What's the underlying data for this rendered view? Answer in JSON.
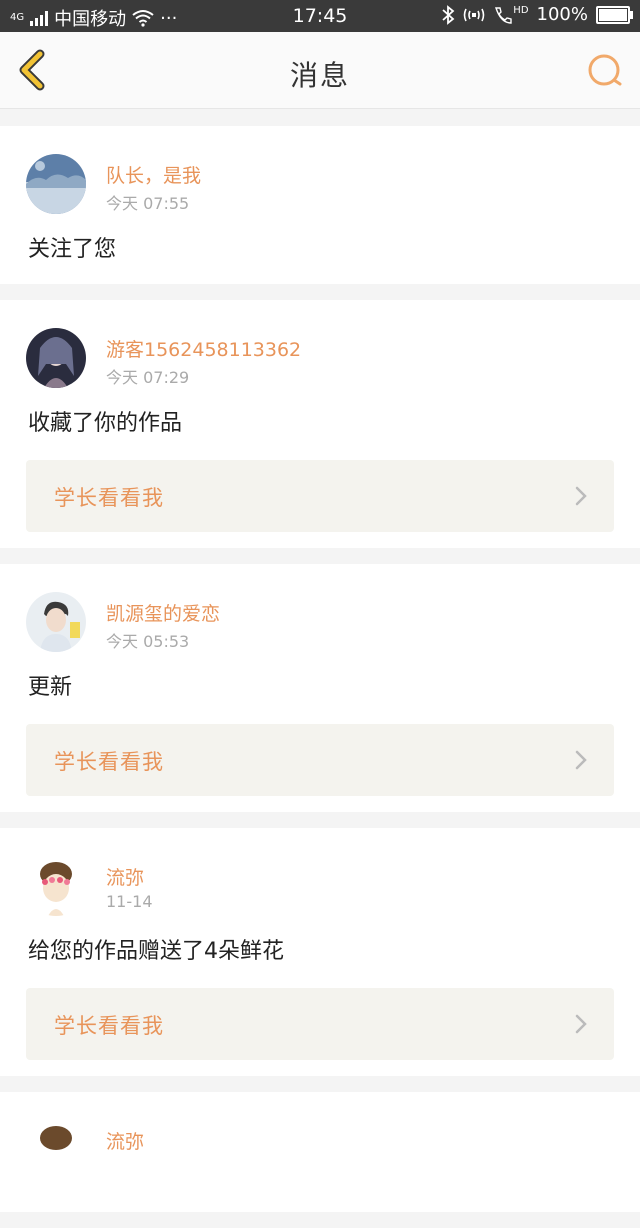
{
  "status_bar": {
    "network": "4G",
    "carrier": "中国移动",
    "more": "···",
    "time": "17:45",
    "hd": "HD",
    "battery": "100%"
  },
  "nav": {
    "title": "消息"
  },
  "messages": [
    {
      "username": "队长，是我",
      "time": "今天 07:55",
      "text": "关注了您"
    },
    {
      "username": "游客1562458113362",
      "time": "今天 07:29",
      "text": "收藏了你的作品",
      "work": "学长看看我"
    },
    {
      "username": "凯源玺的爱恋",
      "time": "今天 05:53",
      "text": "更新",
      "work": "学长看看我"
    },
    {
      "username": "流弥",
      "time": "11-14",
      "text": "给您的作品赠送了4朵鲜花",
      "work": "学长看看我"
    },
    {
      "username": "流弥"
    }
  ],
  "colors": {
    "accent": "#e8945a",
    "back_icon": "#f2c335",
    "search_icon": "#f1a96a",
    "status_bar_bg": "#3a3a3a"
  }
}
